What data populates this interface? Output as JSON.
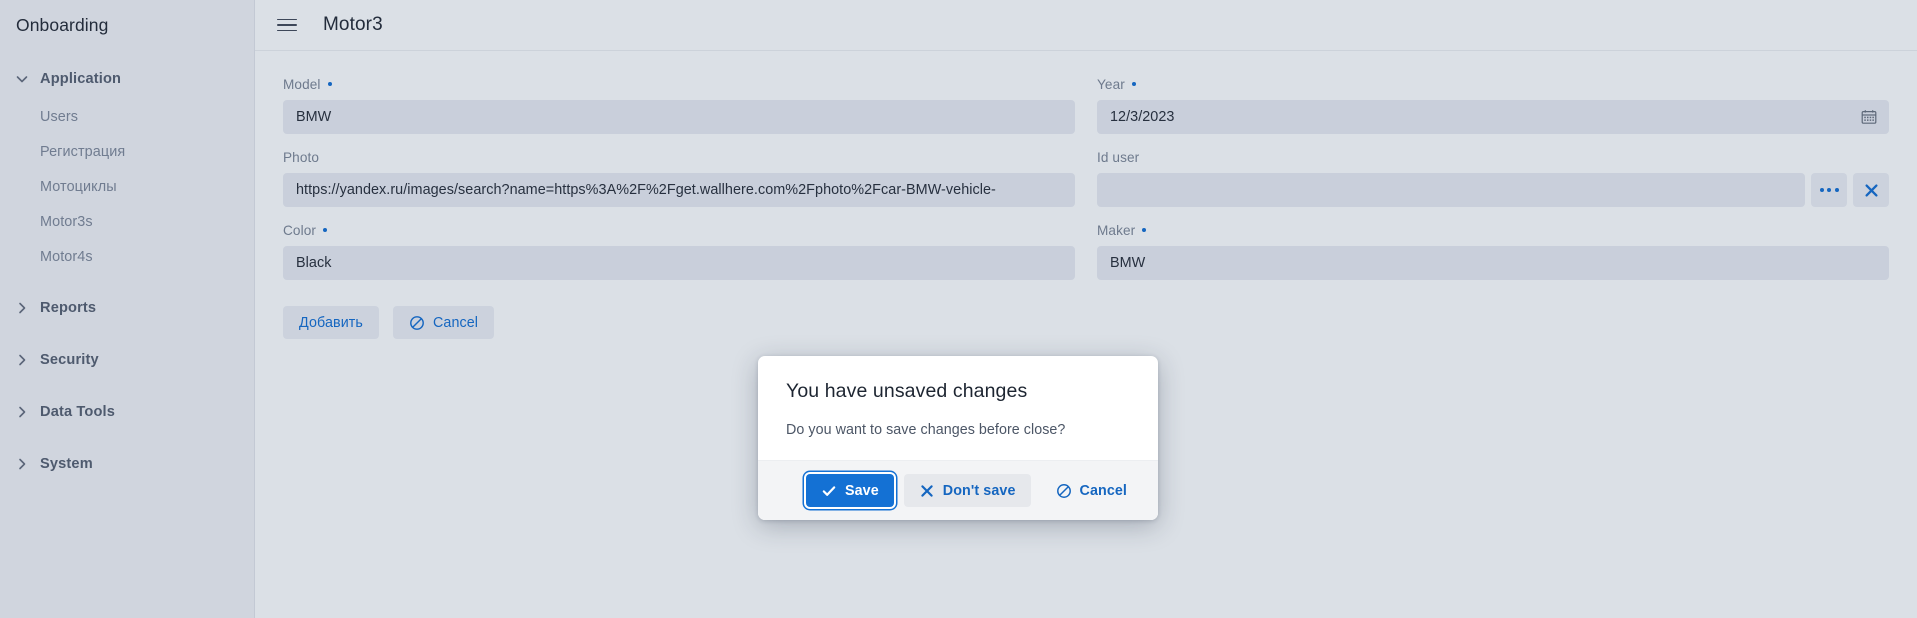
{
  "sidebar": {
    "brand": "Onboarding",
    "groups": [
      {
        "label": "Application",
        "expanded": true,
        "icon": "chevron-down-icon",
        "children": [
          {
            "label": "Users"
          },
          {
            "label": "Регистрация"
          },
          {
            "label": "Мотоциклы"
          },
          {
            "label": "Motor3s"
          },
          {
            "label": "Motor4s"
          }
        ]
      },
      {
        "label": "Reports",
        "expanded": false,
        "icon": "chevron-right-icon",
        "children": []
      },
      {
        "label": "Security",
        "expanded": false,
        "icon": "chevron-right-icon",
        "children": []
      },
      {
        "label": "Data Tools",
        "expanded": false,
        "icon": "chevron-right-icon",
        "children": []
      },
      {
        "label": "System",
        "expanded": false,
        "icon": "chevron-right-icon",
        "children": []
      }
    ]
  },
  "topbar": {
    "menu_icon": "hamburger-menu-icon",
    "title": "Motor3"
  },
  "form": {
    "fields": {
      "model": {
        "label": "Model",
        "required": true,
        "value": "BMW",
        "placeholder": ""
      },
      "year": {
        "label": "Year",
        "required": true,
        "value": "12/3/2023",
        "placeholder": "",
        "icon": "calendar-icon"
      },
      "photo": {
        "label": "Photo",
        "required": false,
        "value": "https://yandex.ru/images/search?name=https%3A%2F%2Fget.wallhere.com%2Fphoto%2Fcar-BMW-vehicle-",
        "placeholder": ""
      },
      "id_user": {
        "label": "Id user",
        "required": false,
        "value": "",
        "placeholder": "",
        "lookup_icon": "ellipsis-icon",
        "clear_icon": "close-x-icon"
      },
      "color": {
        "label": "Color",
        "required": true,
        "value": "Black",
        "placeholder": ""
      },
      "maker": {
        "label": "Maker",
        "required": true,
        "value": "BMW",
        "placeholder": ""
      }
    },
    "actions": {
      "submit": "Добавить",
      "cancel": "Cancel",
      "cancel_icon": "ban-circle-icon"
    }
  },
  "dialog": {
    "title": "You have unsaved changes",
    "message": "Do you want to save changes before close?",
    "buttons": {
      "save": "Save",
      "save_icon": "check-icon",
      "dont_save": "Don't save",
      "dont_save_icon": "close-x-icon",
      "cancel": "Cancel",
      "cancel_icon": "ban-circle-icon"
    }
  },
  "colors": {
    "accent": "#1566c0",
    "primary_button": "#1471d4",
    "sidebar_bg": "#d0d5de",
    "main_bg": "#dbe0e6",
    "input_bg": "#c9cfdb"
  }
}
